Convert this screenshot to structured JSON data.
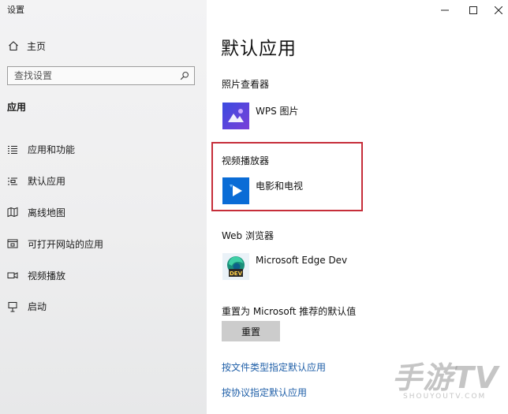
{
  "window": {
    "title": "设置",
    "controls": [
      "minimize",
      "maximize",
      "close"
    ]
  },
  "sidebar": {
    "home_label": "主页",
    "search_placeholder": "查找设置",
    "section_heading": "应用",
    "items": [
      {
        "label": "应用和功能",
        "icon": "apps-list-icon"
      },
      {
        "label": "默认应用",
        "icon": "default-apps-icon"
      },
      {
        "label": "离线地图",
        "icon": "offline-maps-icon"
      },
      {
        "label": "可打开网站的应用",
        "icon": "apps-for-websites-icon"
      },
      {
        "label": "视频播放",
        "icon": "video-playback-icon"
      },
      {
        "label": "启动",
        "icon": "startup-icon"
      }
    ]
  },
  "main": {
    "title": "默认应用",
    "photo_viewer": {
      "heading": "照片查看器",
      "app_name": "WPS 图片",
      "icon": "wps-picture-icon"
    },
    "video_player": {
      "heading": "视频播放器",
      "app_name": "电影和电视",
      "icon": "movies-tv-icon"
    },
    "web_browser": {
      "heading": "Web 浏览器",
      "app_name": "Microsoft Edge Dev",
      "icon": "edge-dev-icon",
      "badge": "DEV"
    },
    "reset": {
      "label": "重置为 Microsoft 推荐的默认值",
      "button": "重置"
    },
    "links": [
      "按文件类型指定默认应用",
      "按协议指定默认应用"
    ]
  },
  "watermark": {
    "text": "手游TV",
    "subtext": "SHOUYOUTV.COM"
  },
  "colors": {
    "highlight_border": "#c62e3a",
    "link": "#1f5fa8",
    "button_bg": "#cccccc"
  }
}
